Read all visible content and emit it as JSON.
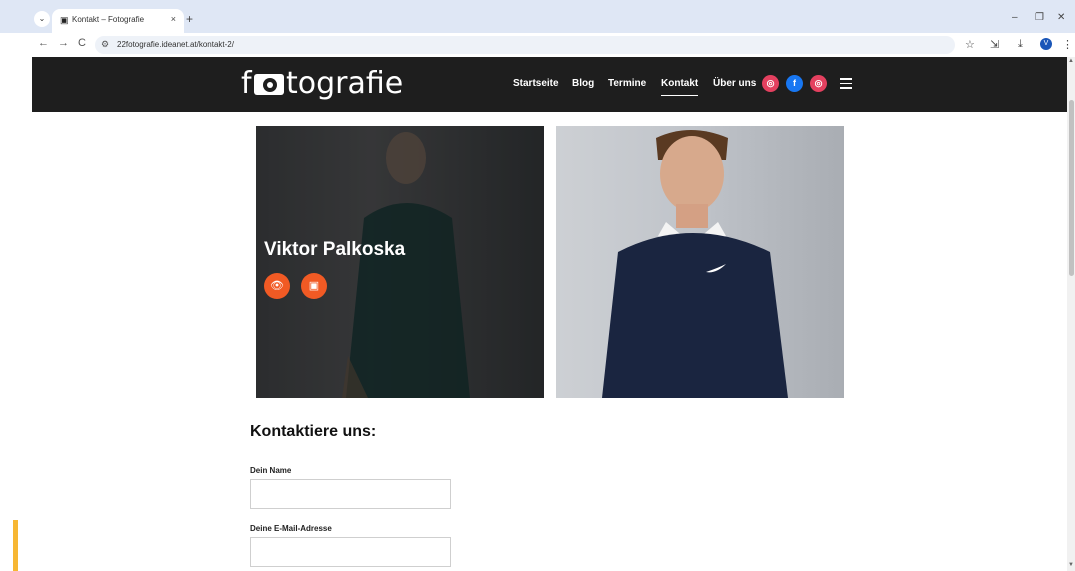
{
  "browser": {
    "tab_menu_icon": "⌄",
    "tab_favicon": "camera-icon",
    "tab_title": "Kontakt – Fotografie",
    "tab_close": "×",
    "new_tab": "+",
    "minimize": "–",
    "restore": "❐",
    "close": "✕",
    "back": "←",
    "forward": "→",
    "reload": "C",
    "site_info": "⚙",
    "url": "22fotografie.ideanet.at/kontakt-2/",
    "star": "☆",
    "extensions": "⇲",
    "download": "⤓",
    "profile_initial": "V",
    "menu": "⋮"
  },
  "header": {
    "logo_f": "f",
    "logo_text": "tografie",
    "nav": [
      {
        "label": "Startseite"
      },
      {
        "label": "Blog"
      },
      {
        "label": "Termine"
      },
      {
        "label": "Kontakt"
      },
      {
        "label": "Über uns"
      }
    ],
    "social": [
      {
        "name": "instagram-icon",
        "glyph": "◎",
        "color": "#e4405f"
      },
      {
        "name": "facebook-icon",
        "glyph": "f",
        "color": "#1877f2"
      },
      {
        "name": "instagram-icon",
        "glyph": "◎",
        "color": "#e4405f"
      }
    ]
  },
  "gallery": {
    "overlay_name": "Viktor Palkoska",
    "view_icon": "👁",
    "card_icon": "▣"
  },
  "form": {
    "title": "Kontaktiere uns:",
    "name_label": "Dein Name",
    "name_value": "",
    "email_label": "Deine E-Mail-Adresse",
    "email_value": ""
  },
  "colors": {
    "accent": "#f15a24",
    "header_bg": "#1e1e1e",
    "left_accent": "#f7b733"
  }
}
